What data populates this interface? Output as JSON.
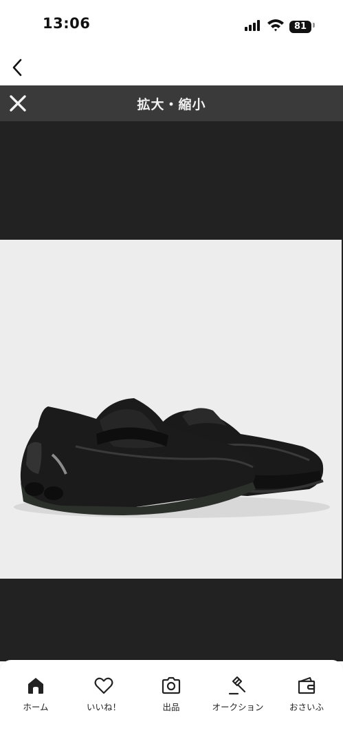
{
  "status_bar": {
    "time": "13:06",
    "battery": "81"
  },
  "viewer": {
    "title": "拡大・縮小"
  },
  "bottom_nav": {
    "items": [
      {
        "label": "ホーム",
        "icon": "home-icon"
      },
      {
        "label": "いいね！",
        "icon": "heart-icon"
      },
      {
        "label": "出品",
        "icon": "camera-icon"
      },
      {
        "label": "オークション",
        "icon": "gavel-icon"
      },
      {
        "label": "おさいふ",
        "icon": "wallet-icon"
      }
    ]
  }
}
